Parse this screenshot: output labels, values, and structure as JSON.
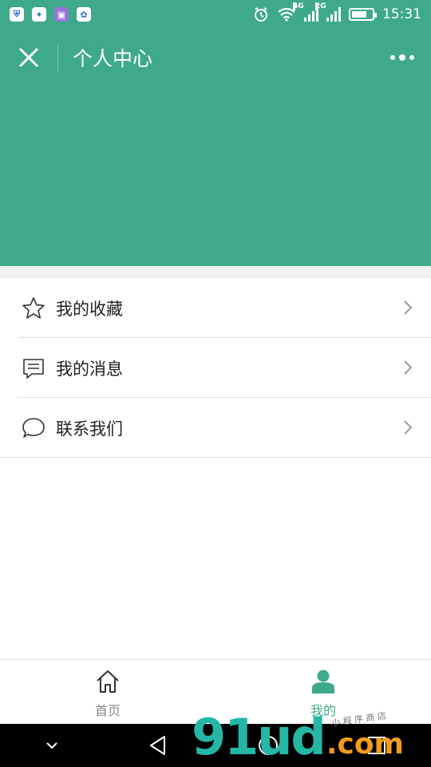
{
  "status_bar": {
    "time": "15:31",
    "net1": "4G",
    "net2": "2G",
    "battery_level": 0.75
  },
  "nav": {
    "title": "个人中心"
  },
  "menu": [
    {
      "label": "我的收藏",
      "icon": "star-icon"
    },
    {
      "label": "我的消息",
      "icon": "message-icon"
    },
    {
      "label": "联系我们",
      "icon": "chat-bubble-icon"
    }
  ],
  "tabbar": {
    "tabs": [
      {
        "label": "首页",
        "icon": "home-icon",
        "active": false
      },
      {
        "label": "我的",
        "icon": "user-icon",
        "active": true
      }
    ]
  },
  "watermark": {
    "main": "91ud",
    "suffix": ".com",
    "small": "小 程 序 商 店"
  },
  "colors": {
    "brand": "#3ea98b",
    "divider": "#e0e0e0",
    "text": "#222222"
  }
}
